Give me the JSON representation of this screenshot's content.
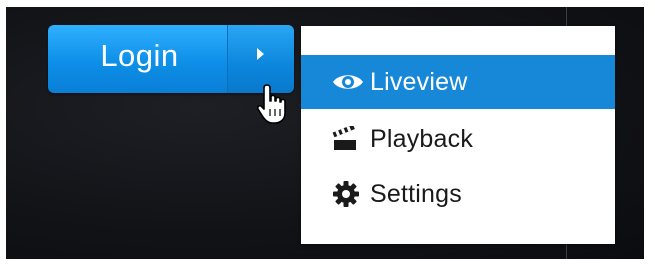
{
  "login_control": {
    "login_label": "Login",
    "expand_icon": "caret-right-icon"
  },
  "cursor": {
    "icon": "hand-pointer-icon"
  },
  "menu": {
    "items": [
      {
        "label": "Liveview",
        "icon": "eye-icon",
        "selected": true
      },
      {
        "label": "Playback",
        "icon": "clapperboard-icon",
        "selected": false
      },
      {
        "label": "Settings",
        "icon": "gear-icon",
        "selected": false
      }
    ]
  },
  "colors": {
    "accent": "#1787d8",
    "button_blue": "#0d8fe8",
    "background": "#121317",
    "menu_background": "#ffffff",
    "menu_text": "#1a1a1a"
  }
}
